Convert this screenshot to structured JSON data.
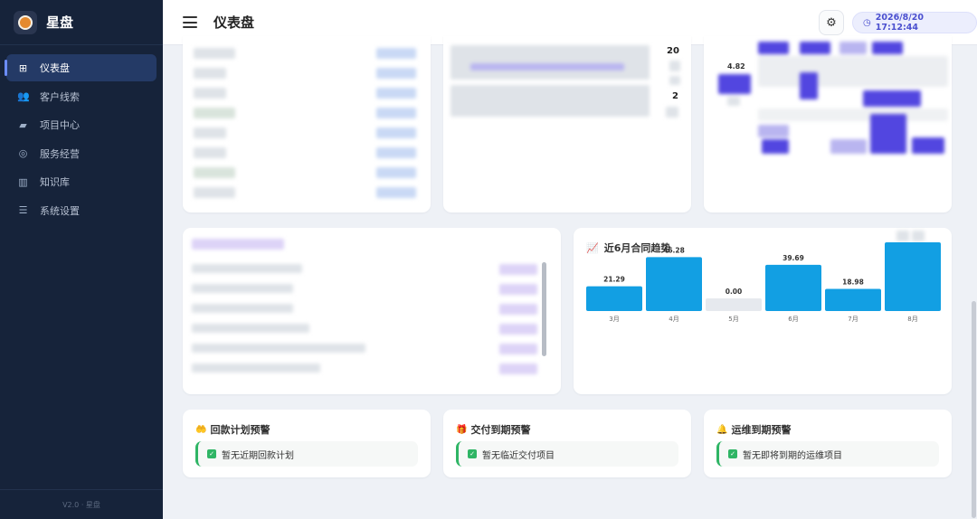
{
  "app": {
    "name": "星盘",
    "version_footer": "V2.0 · 星盘"
  },
  "header": {
    "title": "仪表盘",
    "datetime": "2026/8/20 17:12:44"
  },
  "sidebar": {
    "items": [
      {
        "label": "仪表盘",
        "icon": "grid-icon",
        "active": true
      },
      {
        "label": "客户线索",
        "icon": "users-icon",
        "active": false
      },
      {
        "label": "项目中心",
        "icon": "folder-icon",
        "active": false
      },
      {
        "label": "服务经营",
        "icon": "headset-icon",
        "active": false
      },
      {
        "label": "知识库",
        "icon": "book-icon",
        "active": false
      },
      {
        "label": "系统设置",
        "icon": "sliders-icon",
        "active": false
      }
    ]
  },
  "top_cards": {
    "middle_numbers": [
      "20",
      "2"
    ],
    "right_value": "4.82"
  },
  "contract_trend": {
    "title": "近6月合同趋势",
    "chart_data": {
      "type": "bar",
      "categories": [
        "3月",
        "4月",
        "5月",
        "6月",
        "7月",
        "8月"
      ],
      "values": [
        21.29,
        46.28,
        0.0,
        39.69,
        18.98,
        59.0
      ],
      "value_labels": [
        "21.29",
        "46.28",
        "0.00",
        "39.69",
        "18.98",
        ""
      ],
      "colors": {
        "bar": "#129fe3",
        "zero_bar": "#e6e9ee"
      }
    }
  },
  "alerts": [
    {
      "title": "回款计划预警",
      "icon": "hand-coin-icon",
      "message": "暂无近期回款计划"
    },
    {
      "title": "交付到期预警",
      "icon": "gift-icon",
      "message": "暂无临近交付项目"
    },
    {
      "title": "运维到期预警",
      "icon": "bell-icon",
      "message": "暂无即将到期的运维项目"
    }
  ],
  "colors": {
    "sidebar_bg": "#16233a",
    "accent": "#4a4fcf",
    "success": "#2fb565",
    "bar": "#129fe3"
  }
}
